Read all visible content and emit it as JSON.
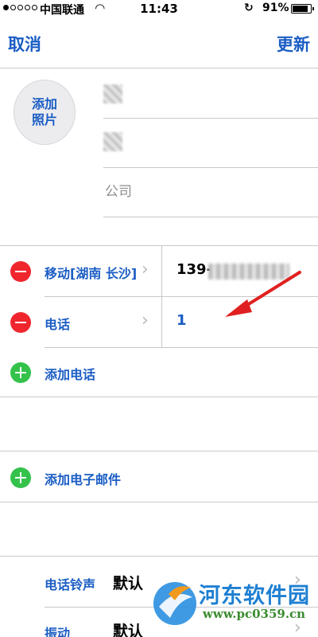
{
  "status_bar": {
    "carrier": "中国联通",
    "time": "11:43",
    "battery": "91%",
    "battery_level": 0.91
  },
  "nav": {
    "cancel": "取消",
    "update": "更新"
  },
  "contact": {
    "add_photo": "添加\n照片",
    "company_placeholder": "公司"
  },
  "phones": [
    {
      "label": "移动[湖南 长沙]",
      "value": "139-"
    },
    {
      "label": "电话",
      "value": "1"
    }
  ],
  "actions": {
    "add_phone": "添加电话",
    "add_email": "添加电子邮件"
  },
  "settings": [
    {
      "label": "电话铃声",
      "value": "默认"
    },
    {
      "label": "振动",
      "value": "默认"
    }
  ],
  "watermark": {
    "name": "河东软件园",
    "url": "www.pc0359.cn"
  },
  "colors": {
    "accent": "#1a5dc4",
    "delete": "#f0262e",
    "add": "#34c24b",
    "arrow": "#e02020"
  },
  "icons": {
    "wifi": "wifi-icon",
    "lock": "orientation-lock-icon",
    "chevron": "chevron-right-icon"
  }
}
